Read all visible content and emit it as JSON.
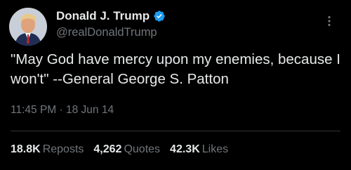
{
  "author": {
    "display_name": "Donald J. Trump",
    "handle": "@realDonaldTrump",
    "verified_color": "#1d9bf0"
  },
  "tweet": {
    "text": "\"May God have mercy upon my enemies, because I won't\" --General George S. Patton",
    "time": "11:45 PM",
    "separator": "·",
    "date": "18 Jun 14"
  },
  "stats": [
    {
      "value": "18.8K",
      "label": "Reposts"
    },
    {
      "value": "4,262",
      "label": "Quotes"
    },
    {
      "value": "42.3K",
      "label": "Likes"
    }
  ],
  "colors": {
    "background": "#000000",
    "primary_text": "#e7e9ea",
    "secondary_text": "#71767b",
    "divider": "#2f3336"
  }
}
